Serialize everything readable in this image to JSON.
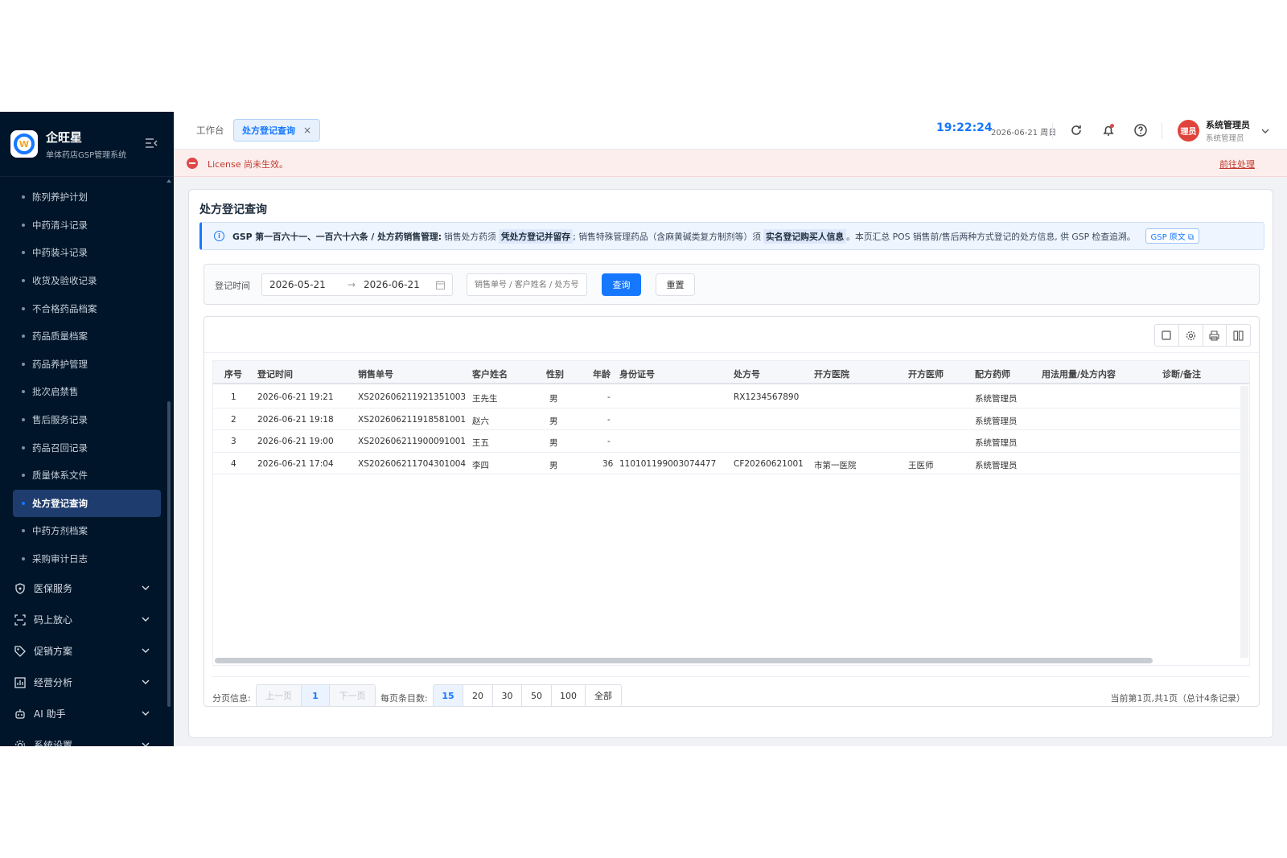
{
  "app": {
    "name": "企旺星",
    "subtitle": "单体药店GSP管理系统"
  },
  "sidebar": {
    "items": [
      {
        "label": "陈列养护计划"
      },
      {
        "label": "中药清斗记录"
      },
      {
        "label": "中药装斗记录"
      },
      {
        "label": "收货及验收记录"
      },
      {
        "label": "不合格药品档案"
      },
      {
        "label": "药品质量档案"
      },
      {
        "label": "药品养护管理"
      },
      {
        "label": "批次启禁售"
      },
      {
        "label": "售后服务记录"
      },
      {
        "label": "药品召回记录"
      },
      {
        "label": "质量体系文件"
      },
      {
        "label": "处方登记查询",
        "active": true
      },
      {
        "label": "中药方剂档案"
      },
      {
        "label": "采购审计日志"
      }
    ],
    "groups": [
      {
        "label": "医保服务",
        "icon": "shield-icon"
      },
      {
        "label": "码上放心",
        "icon": "scan-icon"
      },
      {
        "label": "促销方案",
        "icon": "tag-icon"
      },
      {
        "label": "经营分析",
        "icon": "chart-icon"
      },
      {
        "label": "AI 助手",
        "icon": "robot-icon"
      },
      {
        "label": "系统设置",
        "icon": "gear-icon"
      }
    ]
  },
  "topbar": {
    "tab_home": "工作台",
    "tab_active": "处方登记查询",
    "tab_close": "×",
    "time": "19:22:24",
    "date": "2026-06-21 周日",
    "user_name": "系统管理员",
    "user_role": "系统管理员",
    "avatar_text": "理员"
  },
  "license": {
    "message": "License 尚未生效。",
    "link": "前往处理"
  },
  "page": {
    "title": "处方登记查询",
    "notice": {
      "icon": "i",
      "bold_prefix": "GSP 第一百六十一、一百六十六条 / 处方药销售管理:",
      "text1": "销售处方药须",
      "hl1": "凭处方登记并留存",
      "text2": "; 销售特殊管理药品（含麻黄碱类复方制剂等）须",
      "hl2": "实名登记购买人信息",
      "text3": "。本页汇总 POS 销售前/售后两种方式登记的处方信息, 供 GSP 检查追溯。",
      "button": "GSP 原文 ⧉"
    }
  },
  "filter": {
    "label": "登记时间",
    "date_start": "2026-05-21",
    "date_sep": "→",
    "date_end": "2026-06-21",
    "search_placeholder": "销售单号 / 客户姓名 / 处方号",
    "query_button": "查询",
    "reset_button": "重置"
  },
  "table": {
    "columns": [
      "序号",
      "登记时间",
      "销售单号",
      "客户姓名",
      "性别",
      "年龄",
      "身份证号",
      "处方号",
      "开方医院",
      "开方医师",
      "配方药师",
      "用法用量/处方内容",
      "诊断/备注"
    ],
    "rows": [
      [
        "1",
        "2026-06-21 19:21",
        "XS202606211921351003",
        "王先生",
        "男",
        "-",
        "",
        "RX1234567890",
        "",
        "",
        "系统管理员",
        "",
        ""
      ],
      [
        "2",
        "2026-06-21 19:18",
        "XS202606211918581001",
        "赵六",
        "男",
        "-",
        "",
        "",
        "",
        "",
        "系统管理员",
        "",
        ""
      ],
      [
        "3",
        "2026-06-21 19:00",
        "XS202606211900091001",
        "王五",
        "男",
        "-",
        "",
        "",
        "",
        "",
        "系统管理员",
        "",
        ""
      ],
      [
        "4",
        "2026-06-21 17:04",
        "XS202606211704301004",
        "李四",
        "男",
        "36",
        "110101199003074477",
        "CF20260621001",
        "市第一医院",
        "王医师",
        "系统管理员",
        "",
        ""
      ]
    ]
  },
  "pager": {
    "label": "分页信息:",
    "prev": "上一页",
    "current": "1",
    "next": "下一页",
    "size_label": "每页条目数:",
    "sizes": [
      "15",
      "20",
      "30",
      "50",
      "100",
      "全部"
    ],
    "summary": "当前第1页,共1页（总计4条记录）"
  }
}
